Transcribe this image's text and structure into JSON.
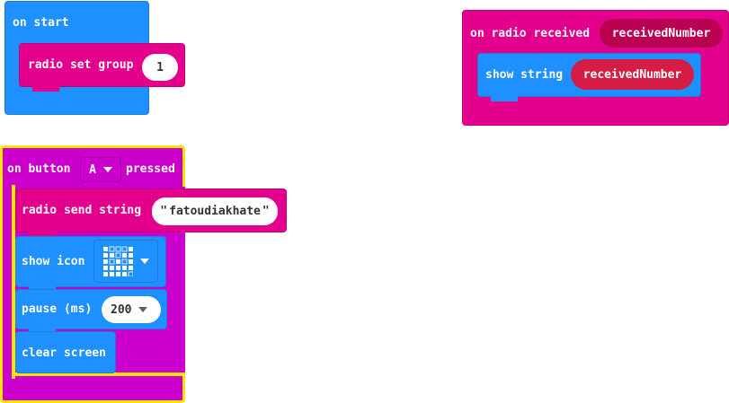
{
  "blocks": {
    "on_start": {
      "label": "on start",
      "radio_set_group": {
        "label": "radio set group",
        "value": "1"
      }
    },
    "on_radio_received": {
      "label": "on radio received",
      "param": "receivedNumber",
      "show_string": {
        "label": "show string",
        "arg": "receivedNumber"
      }
    },
    "on_button_pressed": {
      "label_prefix": "on button",
      "button_value": "A",
      "label_suffix": "pressed",
      "radio_send_string": {
        "label": "radio send string",
        "quote_open": "\"",
        "value": "fatoudiakhate",
        "quote_close": "\""
      },
      "show_icon": {
        "label": "show icon"
      },
      "pause": {
        "label": "pause (ms)",
        "value": "200"
      },
      "clear_screen": {
        "label": "clear screen"
      }
    }
  },
  "colors": {
    "basic_blue": "#1e90ff",
    "basic_blue_border": "#1a7ed9",
    "radio_pink": "#e3008c",
    "radio_pink_border": "#c2007a",
    "input_pink": "#ba0050",
    "input_red": "#d41c45",
    "input_magenta": "#cc00cc",
    "selection_yellow": "#ffe600"
  }
}
